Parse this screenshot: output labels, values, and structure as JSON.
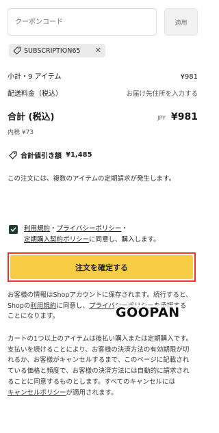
{
  "coupon": {
    "placeholder": "クーポンコード",
    "apply_label": "適用"
  },
  "applied_discount": {
    "code": "SUBSCRIPTION65",
    "icon": "tag-icon",
    "remove_icon": "close-icon"
  },
  "summary": {
    "subtotal_label": "小計・9 アイテム",
    "subtotal_value": "¥981",
    "shipping_label": "配送料金（税込）",
    "shipping_value": "お届け先住所を入力する",
    "total_label": "合計 (税込)",
    "total_currency": "JPY",
    "total_value": "¥981",
    "tax_note": "内税 ¥73",
    "savings_label": "合計値引き額",
    "savings_value": "¥1,485"
  },
  "recurring_note": "この注文には、複数のアイテムの定期請求が発生します。",
  "consent": {
    "checked": true,
    "terms_link": "利用規約",
    "sep1": "・",
    "privacy_link": "プライバシーポリシー",
    "sep2": "・",
    "subscription_link": "定期購入契約ポリシー",
    "suffix": "に同意し、購入します。"
  },
  "confirm_button": "注文を確定する",
  "shop_note": {
    "part1": "お客様の情報はShopアカウントに保存されます。続行すると、Shopの",
    "terms_link": "利用規約",
    "part2": "に同意し、",
    "privacy_link": "プライバシーポリシー",
    "part3": "を承諾することになります。"
  },
  "watermark": "GOOPAN",
  "deferred_note": {
    "text": "カートの1つ以上のアイテムは後払い購入または定期購入です。支払いを続けることにより、お客様の決済方法の有効期限が切れるか、お客様がキャンセルするまで、このページに記載されている価格と頻度で、お客様の決済方法には自動的に請求されることに同意するものとします。すべてのキャンセルには",
    "cancel_link": "キャンセルポリシー",
    "suffix": "が適用されます。"
  },
  "colors": {
    "confirm_button_bg": "#f6cd44",
    "highlight_border": "#e8372a",
    "checkbox_bg": "#1f3c2e"
  }
}
